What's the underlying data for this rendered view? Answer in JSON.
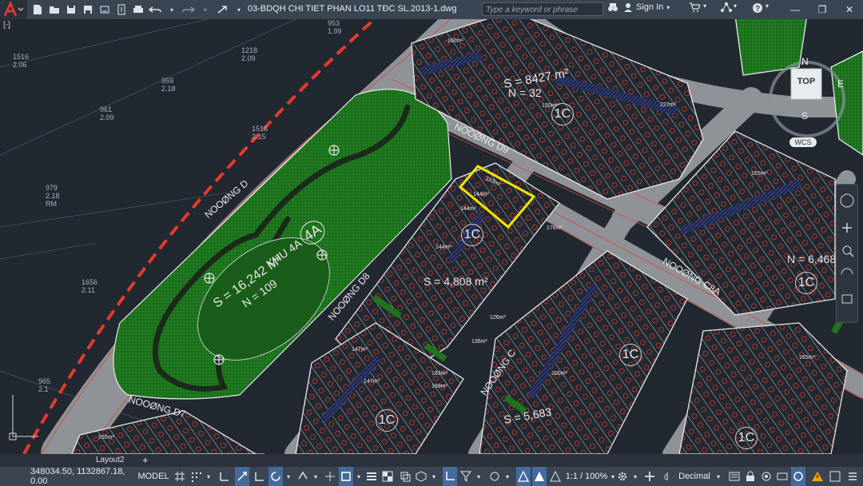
{
  "window": {
    "title": "03-BDQH CHI TIET PHAN LO11 TĐC SL.2013-1.dwg",
    "search_placeholder": "Type a keyword or phrase",
    "sign_in": "Sign In"
  },
  "quick_access": [
    "new-icon",
    "open-icon",
    "save-icon",
    "save-as-icon",
    "cloud-open-icon",
    "cloud-save-icon",
    "plot-icon",
    "undo-icon",
    "redo-icon",
    "share-icon"
  ],
  "view": {
    "cube_top": "TOP",
    "north": "N",
    "south": "S",
    "east": "E",
    "wcs": "WCS"
  },
  "drawing": {
    "roads": [
      "NOOØNG D",
      "NOOØNG D9",
      "NOOØNG D8",
      "NOOØNG C",
      "NOOØNG C8A",
      "NOOØNG D7"
    ],
    "park_label": "KHU 4A",
    "park_zone": "4A",
    "park_stats": "S = 16,242 M²",
    "park_n": "N = 109",
    "block_stats": [
      "S = 8427 m²",
      "N = 32",
      "S = 4,808 m²",
      "N = 6,468",
      "S = 5,683"
    ],
    "zones": [
      "1C",
      "1C",
      "1C",
      "1C",
      "1C",
      "1C"
    ],
    "lot_area_labels": [
      "193m²",
      "144m²",
      "144m²",
      "144m²",
      "165m²",
      "176m²",
      "126m²",
      "147m²",
      "150m²",
      "160m²",
      "183m²",
      "227m²",
      "165m²",
      "155m²",
      "188m²",
      "200m²",
      "136m²",
      "147m²"
    ],
    "survey_points": [
      {
        "code": "1516",
        "elev": "2.06"
      },
      {
        "code": "1218",
        "elev": "2.09"
      },
      {
        "code": "959",
        "elev": "2.18"
      },
      {
        "code": "961",
        "elev": "2.09"
      },
      {
        "code": "1518",
        "elev": "2.15"
      },
      {
        "code": "979",
        "elev": "2.18"
      },
      {
        "code": "1656",
        "elev": "2.11"
      },
      {
        "code": "965",
        "elev": "2.1"
      },
      {
        "code": "953",
        "elev": "1.99"
      }
    ],
    "rm_label": "RM"
  },
  "tabs": {
    "layout2": "Layout2",
    "add": "+"
  },
  "status": {
    "coords": "348034.50, 1132867.18, 0.00",
    "model": "MODEL",
    "scale": "1:1 / 100%",
    "units": "Decimal"
  },
  "colors": {
    "background": "#212830",
    "road": "#8f9296",
    "park": "#1f7a1f",
    "lot_outline": "#e7e9ec",
    "red_line": "#e53b2a",
    "blue_hatch": "#2f44c6",
    "highlight": "#f2e600"
  }
}
